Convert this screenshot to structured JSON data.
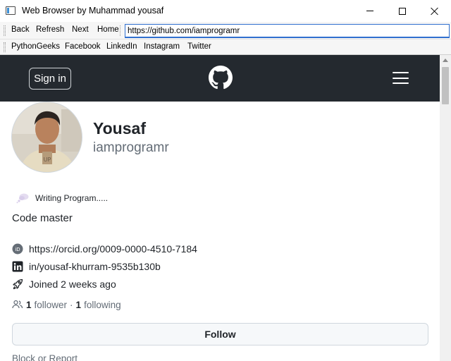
{
  "window": {
    "title": "Web Browser by Muhammad yousaf",
    "controls": [
      "minimize-icon",
      "maximize-icon",
      "close-icon"
    ]
  },
  "navbar": {
    "back": "Back",
    "refresh": "Refresh",
    "next": "Next",
    "home": "Home",
    "url": "https://github.com/iamprogramr"
  },
  "bookmarks": [
    "PythonGeeks",
    "Facebook",
    "LinkedIn",
    "Instagram",
    "Twitter"
  ],
  "page": {
    "header": {
      "sign_in": "Sign in",
      "logo_icon": "github-icon",
      "menu_icon": "hamburger-menu-icon",
      "background": "#24292f"
    },
    "profile": {
      "name": "Yousaf",
      "login": "iamprogramr",
      "status": "Writing Program.....",
      "bio": "Code master",
      "orcid": "https://orcid.org/0009-0000-4510-7184",
      "linkedin": "in/yousaf-khurram-9535b130b",
      "joined": "Joined 2 weeks ago",
      "followers_count": "1",
      "followers_label": "follower",
      "separator": "·",
      "following_count": "1",
      "following_label": "following",
      "follow_button": "Follow",
      "block_report": "Block or Report"
    }
  },
  "colors": {
    "accent": "#2f6fcf",
    "muted_text": "#636c76",
    "text": "#1f2328"
  }
}
